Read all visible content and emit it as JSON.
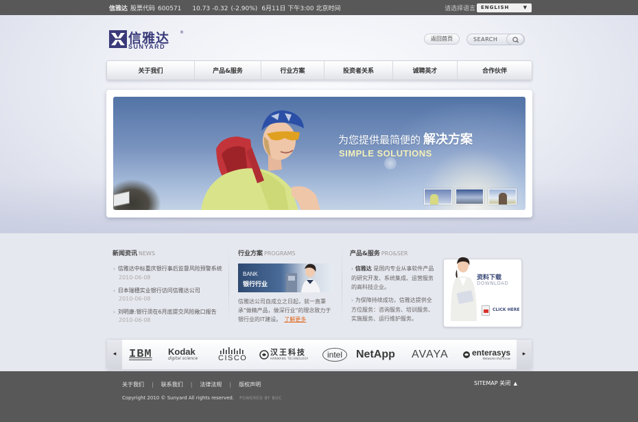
{
  "topbar": {
    "company": "信雅达",
    "stock_label": "股票代码",
    "stock_code": "600571",
    "price": "10.73",
    "change": "-0.32",
    "change_pct": "(-2.90%)",
    "time": "6月11日 下午3:00 北京时间",
    "lang_prompt": "请选择语言",
    "lang_button": "ENGLISH"
  },
  "logo": {
    "cn": "信雅达",
    "en": "SUNYARD",
    "reg": "®"
  },
  "header": {
    "home_label": "返回首页",
    "search_placeholder": "SEARCH"
  },
  "nav": [
    {
      "label": "关于我们"
    },
    {
      "label": "产品&服务"
    },
    {
      "label": "行业方案"
    },
    {
      "label": "投资者关系"
    },
    {
      "label": "诚聘英才"
    },
    {
      "label": "合作伙伴"
    }
  ],
  "banner": {
    "headline_prefix": "为您提供最简便的",
    "headline_strong": "解决方案",
    "sub": "SIMPLE SOLUTIONS"
  },
  "news": {
    "title": "新闻资讯",
    "title_en": "NEWS",
    "items": [
      {
        "text": "信雅达中标重庆银行事后监督风险预警系统",
        "date": "2010-06-08"
      },
      {
        "text": "日本瑞穗实业银行访问信雅达公司",
        "date": "2010-06-08"
      },
      {
        "text": "刘明康:银行须在6月底提交风险敞口报告",
        "date": "2010-06-08"
      }
    ]
  },
  "programs": {
    "title": "行业方案",
    "title_en": "PROGRAMS",
    "img_en": "BANK",
    "img_cn": "银行行业",
    "text": "信雅达公司自成立之日起，就一直秉承\"做精产品，做深行业\"的理念致力于银行业的IT建设。",
    "more": "了解更多"
  },
  "products": {
    "title": "产品&服务",
    "title_en": "PRO&SER",
    "p1_strong": "信雅达",
    "p1_text": "是国内专业从事软件产品的研究开发、系统集成、运营服务的高科技企业。",
    "p2_text": "为保障持续成功，信雅达提供全方位服务：咨询服务、培训服务、实施服务、运行维护服务。"
  },
  "download": {
    "cn": "资料下载",
    "en": "DOWNLOAD",
    "click": "CLICK HERE"
  },
  "partners": {
    "prev": "◂",
    "next": "▸",
    "logos": [
      {
        "name": "IBM"
      },
      {
        "name": "Kodak",
        "sub": "digital science"
      },
      {
        "name": "CISCO"
      },
      {
        "name": "汉王科技",
        "sub": "HANWANG TECHNOLOGY"
      },
      {
        "name": "intel"
      },
      {
        "name": "NetApp"
      },
      {
        "name": "AVAYA"
      },
      {
        "name": "enterasys",
        "sub": "Networks that Know"
      }
    ]
  },
  "footer": {
    "links": [
      "关于我们",
      "联系我们",
      "法律法规",
      "版权声明"
    ],
    "sitemap": "SITEMAP 关闭",
    "copyright": "Copyright 2010 © Sunyard All rights reserved.",
    "powered": "POWERED BY BOC"
  },
  "colors": {
    "topbar": "#585858",
    "brand": "#3a3a7a",
    "accent_link": "#e06418",
    "footer": "#585858"
  }
}
